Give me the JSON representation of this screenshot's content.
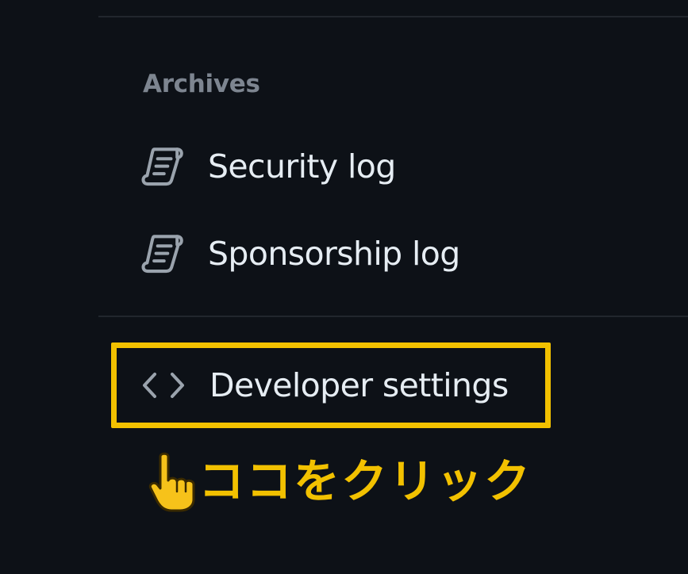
{
  "sidebar": {
    "archives_heading": "Archives",
    "items": [
      {
        "label": "Security log",
        "icon": "log-icon"
      },
      {
        "label": "Sponsorship log",
        "icon": "log-icon"
      }
    ],
    "developer_settings": {
      "label": "Developer settings",
      "icon": "code-icon"
    }
  },
  "annotation": {
    "text": "ココをクリック",
    "icon": "pointing-hand-icon",
    "highlight_color": "#f2c100"
  },
  "colors": {
    "background": "#0d1117",
    "text": "#e6edf3",
    "muted": "#7d8590",
    "divider": "#21262d",
    "accent": "#f2c100"
  }
}
